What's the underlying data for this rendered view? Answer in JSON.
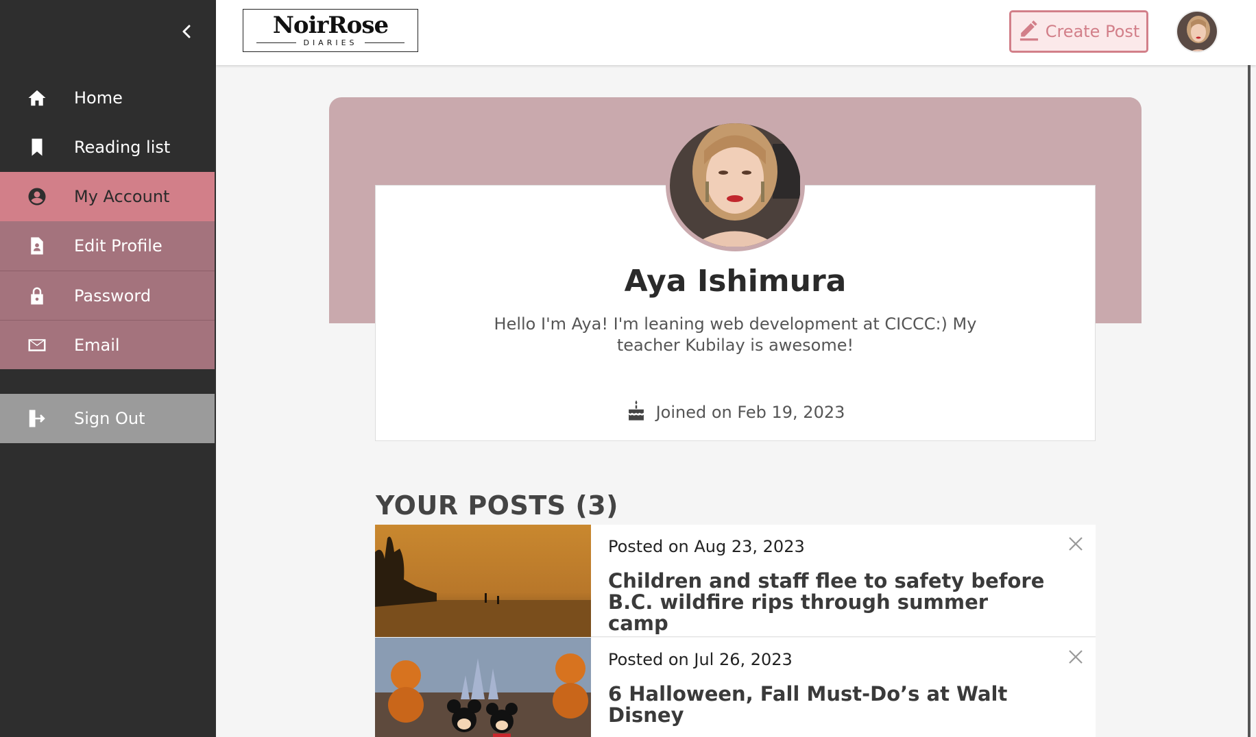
{
  "sidebar": {
    "collapse_icon": "chevron-left-icon",
    "items": [
      {
        "label": "Home",
        "icon": "home-icon"
      },
      {
        "label": "Reading list",
        "icon": "bookmark-icon"
      },
      {
        "label": "My Account",
        "icon": "account-circle-icon"
      },
      {
        "label": "Edit Profile",
        "icon": "profile-document-icon"
      },
      {
        "label": "Password",
        "icon": "lock-icon"
      },
      {
        "label": "Email",
        "icon": "mail-icon"
      },
      {
        "label": "Sign Out",
        "icon": "sign-out-icon"
      }
    ]
  },
  "header": {
    "logo_main": "NoirRose",
    "logo_sub": "DIARIES",
    "create_post_label": "Create Post",
    "create_post_icon": "pencil-icon"
  },
  "profile": {
    "name": "Aya Ishimura",
    "bio": "Hello I'm Aya! I'm leaning web development at CICCC:) My teacher Kubilay is awesome!",
    "joined": "Joined on Feb 19, 2023",
    "joined_icon": "cake-icon"
  },
  "posts": {
    "heading": "YOUR POSTS (3)",
    "items": [
      {
        "date": "Posted on Aug 23, 2023",
        "title": "Children and staff flee to safety before B.C. wildfire rips through summer camp"
      },
      {
        "date": "Posted on Jul 26, 2023",
        "title": "6 Halloween, Fall Must-Do’s at Walt Disney"
      }
    ]
  },
  "colors": {
    "sidebar_bg": "#2e2e2e",
    "active": "#d27f89",
    "submenu": "#a4737d",
    "banner": "#c9a9ad",
    "signout": "#9b9b9b"
  }
}
